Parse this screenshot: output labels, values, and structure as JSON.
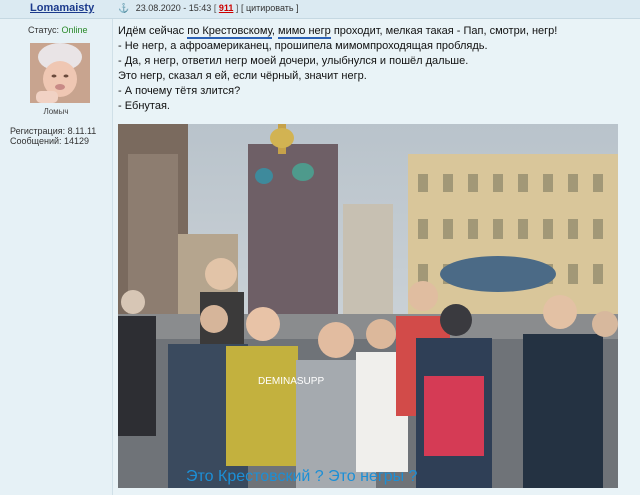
{
  "post": {
    "username": "Lomamaisty",
    "date": "23.08.2020 - 15:43",
    "sep_open": "[",
    "number": "911",
    "sep_close": "]",
    "quote": "[ цитировать ]"
  },
  "sidebar": {
    "status_label": "Статус:",
    "status_value": "Online",
    "user_title": "Ломыч",
    "registration": "Регистрация: 8.11.11",
    "messages": "Сообщений: 14129"
  },
  "text": {
    "l1_a": "Идём сейчас ",
    "l1_b": "по Крестовскому",
    "l1_c": ", ",
    "l1_d": "мимо негр",
    "l1_e": " проходит, мелкая такая - Пап, смотри, негр!",
    "l2": "- Не негр, а афроамериканец, прошипела мимомпроходящая проблядь.",
    "l3": "- Да, я негр, ответил негр моей дочери, улыбнулся и пошёл дальше.",
    "l4": "Это негр, сказал я ей, если чёрный, значит негр.",
    "l5": "- А почему тётя злится?",
    "l6": "- Ебнутая."
  },
  "image": {
    "caption": "Это Крестовский ? Это негры ?",
    "overlay_text": "DEMINASUPP"
  },
  "colors": {
    "link": "#1b3a8c",
    "post_number": "#cc0000",
    "online": "#2a8a2a",
    "caption": "#1c8fd6",
    "underline": "#2c62b6"
  }
}
